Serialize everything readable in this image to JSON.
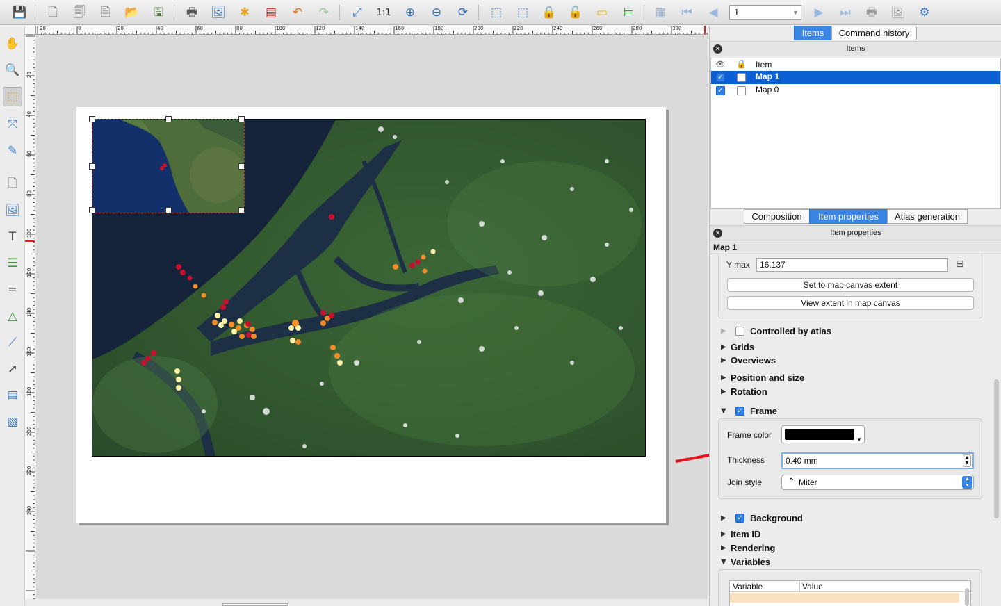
{
  "toolbar": {
    "page_value": "1",
    "icons": [
      "save-icon",
      "new-composer-icon",
      "duplicate-composer-icon",
      "composer-manager-icon",
      "open-template-icon",
      "save-template-icon",
      "print-icon",
      "export-image-icon",
      "export-svg-icon",
      "export-pdf-icon",
      "undo-icon",
      "redo-icon",
      "zoom-full-icon",
      "zoom-100-icon",
      "zoom-in-icon",
      "zoom-out-icon",
      "refresh-icon",
      "group-icon",
      "ungroup-icon",
      "lock-icon",
      "unlock-icon",
      "raise-icon",
      "align-icon",
      "atlas-preview-icon",
      "first-feature-icon",
      "previous-feature-icon",
      "next-feature-icon",
      "last-feature-icon",
      "print-atlas-icon",
      "export-atlas-icon",
      "atlas-settings-icon"
    ]
  },
  "rulers": {
    "h_labels": [
      "20",
      "0",
      "20",
      "40",
      "60",
      "80",
      "100",
      "120",
      "140",
      "160",
      "180",
      "200",
      "220",
      "240",
      "260",
      "280",
      "300"
    ],
    "v_labels": [
      "20",
      "40",
      "60",
      "80",
      "100",
      "120",
      "140",
      "160",
      "180",
      "200",
      "220",
      "240"
    ]
  },
  "panel": {
    "top_tabs": [
      "Items",
      "Command history"
    ],
    "items_header": "Items",
    "columns": {
      "item": "Item"
    },
    "items": [
      {
        "name": "Map 1",
        "visible": true,
        "locked": false,
        "selected": true
      },
      {
        "name": "Map 0",
        "visible": true,
        "locked": false,
        "selected": false
      }
    ],
    "bottom_tabs": [
      "Composition",
      "Item properties",
      "Atlas generation"
    ],
    "props_header": "Item properties",
    "item_title": "Map 1",
    "ymax_label": "Y max",
    "ymax_value": "16.137",
    "btn_set_extent": "Set to map canvas extent",
    "btn_view_extent": "View extent in map canvas",
    "sections": {
      "controlled": "Controlled by atlas",
      "grids": "Grids",
      "overviews": "Overviews",
      "position": "Position and size",
      "rotation": "Rotation",
      "frame": "Frame",
      "background": "Background",
      "item_id": "Item ID",
      "rendering": "Rendering",
      "variables": "Variables"
    },
    "frame": {
      "color_label": "Frame color",
      "color": "#000000",
      "thickness_label": "Thickness",
      "thickness_value": "0.40 mm",
      "join_label": "Join style",
      "join_value": "Miter"
    },
    "variables_table": {
      "col_variable": "Variable",
      "col_value": "Value"
    }
  },
  "colors": {
    "accent": "#3b86e4",
    "selection": "#0b5fd3",
    "annotation_arrow": "#e3161b",
    "point_red": "#c8102e",
    "point_orange": "#f28c28",
    "point_yellow": "#fff2a8"
  }
}
